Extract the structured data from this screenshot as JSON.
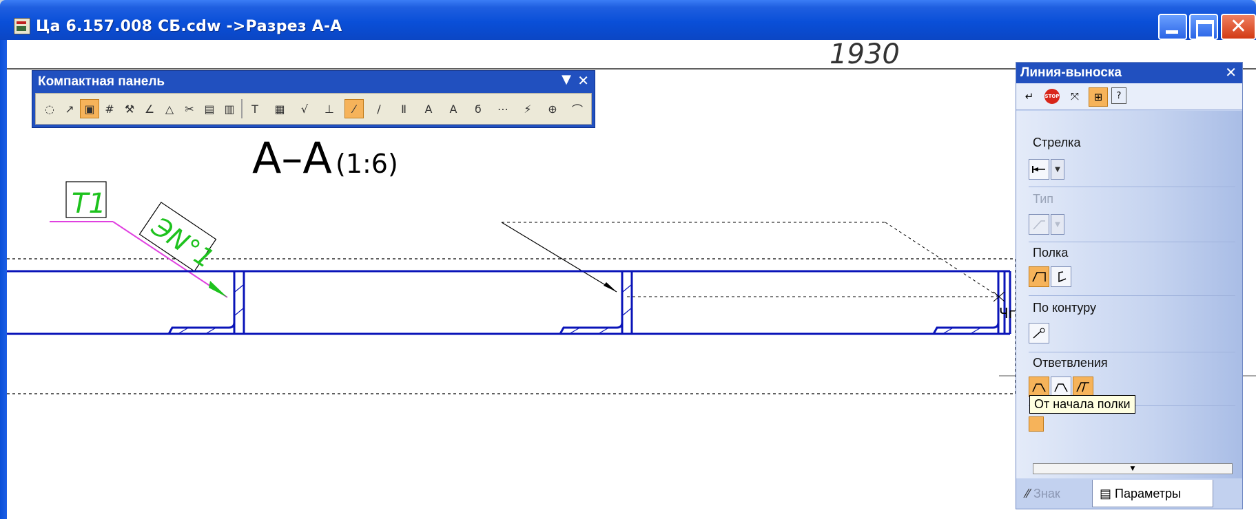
{
  "window": {
    "title": "Ца 6.157.008 СБ.cdw ->Разрез А-А",
    "close_glyph": "✕"
  },
  "drawing": {
    "top_fragment": "1930",
    "section_label": "А–А",
    "section_scale": "(1:6)",
    "marker_t1": "Т1",
    "marker_weld": "ЭN°1",
    "cut_text": "Чго"
  },
  "compact_panel": {
    "title": "Компактная панель",
    "menu_glyph": "▼",
    "close_glyph": "✕",
    "tools": [
      {
        "name": "geometry-icon",
        "glyph": "◌"
      },
      {
        "name": "dimensions-icon",
        "glyph": "↗"
      },
      {
        "name": "designations-icon",
        "glyph": "▣",
        "active": true
      },
      {
        "name": "edit-icon",
        "glyph": "#"
      },
      {
        "name": "parametrization-icon",
        "glyph": "⚒"
      },
      {
        "name": "measure-icon",
        "glyph": "∠"
      },
      {
        "name": "select-icon",
        "glyph": "△"
      },
      {
        "name": "associative-view-icon",
        "glyph": "✂"
      },
      {
        "name": "spec-icon",
        "glyph": "▤"
      },
      {
        "name": "reports-icon",
        "glyph": "▥"
      },
      {
        "name": "text-icon",
        "glyph": "T"
      },
      {
        "name": "table-icon",
        "glyph": "▦"
      },
      {
        "name": "roughness-icon",
        "glyph": "√"
      },
      {
        "name": "base-icon",
        "glyph": "⊥"
      },
      {
        "name": "leader-line-icon",
        "glyph": "⁄",
        "active": true
      },
      {
        "name": "tolerance-icon",
        "glyph": "∕"
      },
      {
        "name": "cut-line-icon",
        "glyph": "Ⅱ"
      },
      {
        "name": "arrow-view-icon",
        "glyph": "A"
      },
      {
        "name": "view-arrow-icon",
        "glyph": "A"
      },
      {
        "name": "remote-element-icon",
        "glyph": "ϭ"
      },
      {
        "name": "axis-line-icon",
        "glyph": "⋯"
      },
      {
        "name": "wave-line-icon",
        "glyph": "⚡"
      },
      {
        "name": "center-mark-icon",
        "glyph": "⊕"
      },
      {
        "name": "arc-icon",
        "glyph": "⌒"
      }
    ]
  },
  "properties": {
    "title": "Линия-выноска",
    "close_glyph": "✕",
    "toolbar": [
      {
        "name": "create-object-icon",
        "glyph": "↵"
      },
      {
        "name": "stop-icon",
        "glyph": "STOP"
      },
      {
        "name": "snap-icon",
        "glyph": "⤧"
      },
      {
        "name": "auto-create-icon",
        "glyph": "⊞"
      },
      {
        "name": "help-icon",
        "glyph": "?"
      }
    ],
    "arrow_label": "Стрелка",
    "type_label": "Тип",
    "shelf_label": "Полка",
    "contour_label": "По контуру",
    "branches_label": "Ответвления",
    "tooltip": "От начала полки",
    "tabs": {
      "sign": "Знак",
      "params": "Параметры"
    }
  }
}
